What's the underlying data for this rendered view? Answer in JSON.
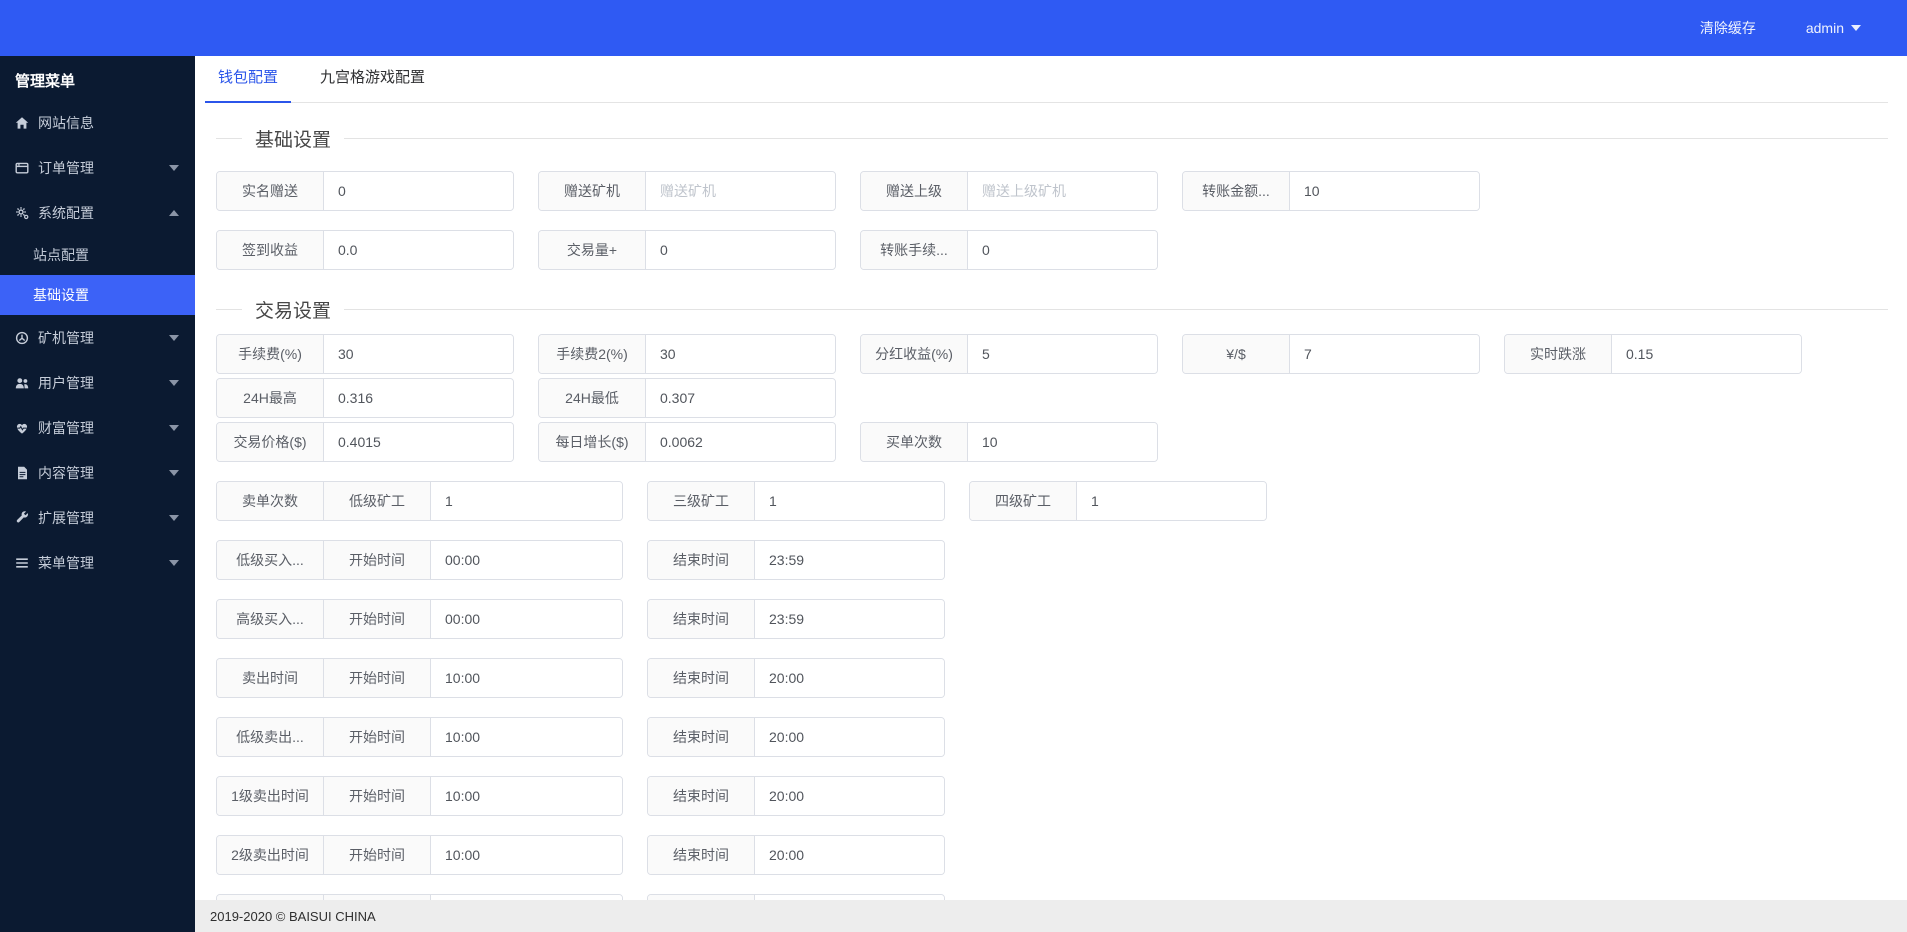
{
  "colors": {
    "topbar_bg": "#2f5af3",
    "sidebar_bg": "#0b1a31",
    "active_item_bg": "#3c62f7",
    "tab_active": "#2b55ea"
  },
  "topbar": {
    "clear_cache": "清除缓存",
    "user": "admin"
  },
  "sidebar": {
    "header": "管理菜单",
    "items": [
      {
        "key": "site-info",
        "icon": "home",
        "label": "网站信息"
      },
      {
        "key": "orders",
        "icon": "orders",
        "label": "订单管理",
        "caret": "down"
      },
      {
        "key": "system",
        "icon": "settings",
        "label": "系统配置",
        "caret": "up",
        "expanded": true,
        "children": [
          {
            "key": "site-config",
            "label": "站点配置"
          },
          {
            "key": "basic-settings",
            "label": "基础设置",
            "active": true
          }
        ]
      },
      {
        "key": "miner",
        "icon": "miner",
        "label": "矿机管理",
        "caret": "down"
      },
      {
        "key": "users",
        "icon": "users",
        "label": "用户管理",
        "caret": "down"
      },
      {
        "key": "wealth",
        "icon": "wealth",
        "label": "财富管理",
        "caret": "down"
      },
      {
        "key": "content",
        "icon": "content",
        "label": "内容管理",
        "caret": "down"
      },
      {
        "key": "extension",
        "icon": "extension",
        "label": "扩展管理",
        "caret": "down"
      },
      {
        "key": "menu",
        "icon": "menu",
        "label": "菜单管理",
        "caret": "down"
      }
    ]
  },
  "tabs": [
    {
      "key": "wallet-config",
      "label": "钱包配置",
      "active": true
    },
    {
      "key": "grid-game-config",
      "label": "九宫格游戏配置"
    }
  ],
  "sections": [
    {
      "title": "基础设置",
      "rows": [
        [
          {
            "labels": [
              "实名赠送"
            ],
            "value": "0"
          },
          {
            "labels": [
              "赠送矿机"
            ],
            "placeholder": "赠送矿机"
          },
          {
            "labels": [
              "赠送上级"
            ],
            "placeholder": "赠送上级矿机"
          },
          {
            "labels": [
              "转账金额..."
            ],
            "value": "10"
          }
        ],
        [
          {
            "labels": [
              "签到收益"
            ],
            "value": "0.0"
          },
          {
            "labels": [
              "交易量+"
            ],
            "value": "0"
          },
          {
            "labels": [
              "转账手续..."
            ],
            "value": "0"
          }
        ]
      ]
    },
    {
      "title": "交易设置",
      "rows": [
        [
          {
            "labels": [
              "手续费(%)"
            ],
            "value": "30"
          },
          {
            "labels": [
              "手续费2(%)"
            ],
            "value": "30"
          },
          {
            "labels": [
              "分红收益(%)"
            ],
            "value": "5"
          },
          {
            "labels": [
              "¥/$"
            ],
            "value": "7"
          },
          {
            "labels": [
              "实时跌涨"
            ],
            "value": "0.15"
          }
        ],
        [
          {
            "labels": [
              "24H最高"
            ],
            "value": "0.316"
          },
          {
            "labels": [
              "24H最低"
            ],
            "value": "0.307"
          }
        ],
        [
          {
            "labels": [
              "交易价格($)"
            ],
            "value": "0.4015"
          },
          {
            "labels": [
              "每日增长($)"
            ],
            "value": "0.0062"
          },
          {
            "labels": [
              "买单次数"
            ],
            "value": "10"
          }
        ],
        [
          {
            "labels": [
              "卖单次数",
              "低级矿工"
            ],
            "value": "1"
          },
          {
            "labels": [
              "三级矿工"
            ],
            "value": "1"
          },
          {
            "labels": [
              "四级矿工"
            ],
            "value": "1"
          }
        ],
        [
          {
            "labels": [
              "低级买入...",
              "开始时间"
            ],
            "value": "00:00"
          },
          {
            "labels": [
              "结束时间"
            ],
            "value": "23:59"
          }
        ],
        [
          {
            "labels": [
              "高级买入...",
              "开始时间"
            ],
            "value": "00:00"
          },
          {
            "labels": [
              "结束时间"
            ],
            "value": "23:59"
          }
        ],
        [
          {
            "labels": [
              "卖出时间",
              "开始时间"
            ],
            "value": "10:00"
          },
          {
            "labels": [
              "结束时间"
            ],
            "value": "20:00"
          }
        ],
        [
          {
            "labels": [
              "低级卖出...",
              "开始时间"
            ],
            "value": "10:00"
          },
          {
            "labels": [
              "结束时间"
            ],
            "value": "20:00"
          }
        ],
        [
          {
            "labels": [
              "1级卖出时间",
              "开始时间"
            ],
            "value": "10:00"
          },
          {
            "labels": [
              "结束时间"
            ],
            "value": "20:00"
          }
        ],
        [
          {
            "labels": [
              "2级卖出时间",
              "开始时间"
            ],
            "value": "10:00"
          },
          {
            "labels": [
              "结束时间"
            ],
            "value": "20:00"
          }
        ],
        [
          {
            "labels": [
              "",
              ""
            ],
            "value": ""
          },
          {
            "labels": [
              ""
            ],
            "value": ""
          }
        ]
      ]
    }
  ],
  "footer": {
    "copyright": "2019-2020 © BAISUI CHINA"
  }
}
